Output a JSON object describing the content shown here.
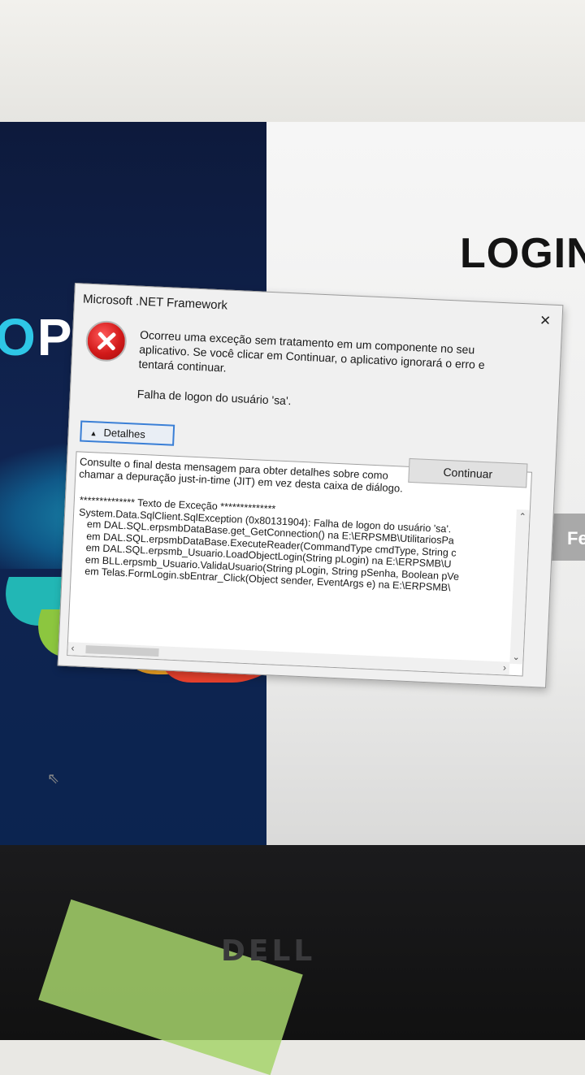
{
  "background": {
    "logo_text_prefix": "O",
    "logo_text_suffix": "P",
    "login_title": "LOGIN",
    "side_button_label": "Fe",
    "monitor_brand": "DELL"
  },
  "dialog": {
    "title": "Microsoft .NET Framework",
    "close_icon": "×",
    "message": "Ocorreu uma exceção sem tratamento em um componente no seu aplicativo. Se você clicar em Continuar, o aplicativo ignorará o erro e tentará continuar.",
    "error_message": "Falha de logon do usuário 'sa'.",
    "details_label": "Detalhes",
    "continue_label": "Continuar",
    "details_intro": "Consulte o final desta mensagem para obter detalhes sobre como chamar a depuração just-in-time (JIT) em vez desta caixa de diálogo.",
    "details_text": "************** Texto de Exceção **************\nSystem.Data.SqlClient.SqlException (0x80131904): Falha de logon do usuário 'sa'.\n   em DAL.SQL.erpsmbDataBase.get_GetConnection() na E:\\ERPSMB\\UtilitariosPa\n   em DAL.SQL.erpsmbDataBase.ExecuteReader(CommandType cmdType, String c\n   em DAL.SQL.erpsmb_Usuario.LoadObjectLogin(String pLogin) na E:\\ERPSMB\\U\n   em BLL.erpsmb_Usuario.ValidaUsuario(String pLogin, String pSenha, Boolean pVe\n   em Telas.FormLogin.sbEntrar_Click(Object sender, EventArgs e) na E:\\ERPSMB\\"
  },
  "colors": {
    "accent": "#3a7fd6",
    "error_red": "#d21a1a",
    "panel_navy": "#102451"
  }
}
